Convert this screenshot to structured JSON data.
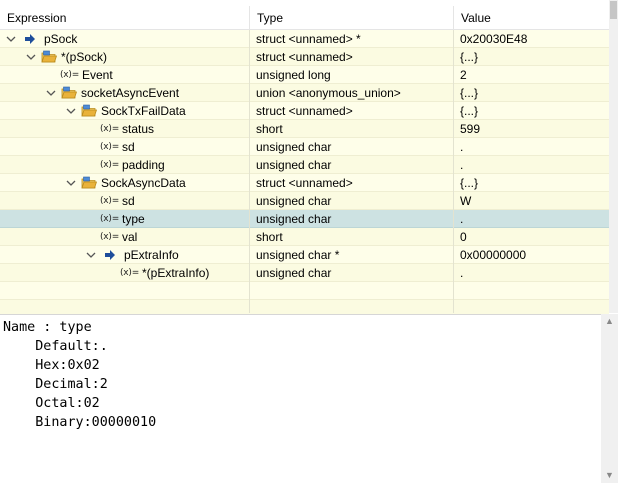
{
  "header": {
    "col_expression": "Expression",
    "col_type": "Type",
    "col_value": "Value"
  },
  "rows": [
    {
      "label": "pSock",
      "type": "struct <unnamed> *",
      "value": "0x20030E48",
      "icon": "pointer-arrow-icon",
      "expander": "expanded"
    },
    {
      "label": "*(pSock)",
      "type": "struct <unnamed>",
      "value": "{...}",
      "icon": "struct-folder-icon",
      "expander": "expanded"
    },
    {
      "label": "Event",
      "type": "unsigned long",
      "value": "2",
      "icon": "variable-icon",
      "expander": "none"
    },
    {
      "label": "socketAsyncEvent",
      "type": "union <anonymous_union>",
      "value": "{...}",
      "icon": "struct-folder-icon",
      "expander": "expanded"
    },
    {
      "label": "SockTxFailData",
      "type": "struct <unnamed>",
      "value": "{...}",
      "icon": "struct-folder-icon",
      "expander": "expanded"
    },
    {
      "label": "status",
      "type": "short",
      "value": "599",
      "icon": "variable-icon",
      "expander": "none"
    },
    {
      "label": "sd",
      "type": "unsigned char",
      "value": ".",
      "icon": "variable-icon",
      "expander": "none"
    },
    {
      "label": "padding",
      "type": "unsigned char",
      "value": ".",
      "icon": "variable-icon",
      "expander": "none"
    },
    {
      "label": "SockAsyncData",
      "type": "struct <unnamed>",
      "value": "{...}",
      "icon": "struct-folder-icon",
      "expander": "expanded"
    },
    {
      "label": "sd",
      "type": "unsigned char",
      "value": "W",
      "icon": "variable-icon",
      "expander": "none"
    },
    {
      "label": "type",
      "type": "unsigned char",
      "value": ".",
      "icon": "variable-icon",
      "expander": "none",
      "selected": true
    },
    {
      "label": "val",
      "type": "short",
      "value": "0",
      "icon": "variable-icon",
      "expander": "none"
    },
    {
      "label": "pExtraInfo",
      "type": "unsigned char *",
      "value": "0x00000000",
      "icon": "pointer-arrow-icon",
      "expander": "expanded"
    },
    {
      "label": "*(pExtraInfo)",
      "type": "unsigned char",
      "value": ".",
      "icon": "variable-icon",
      "expander": "none"
    }
  ],
  "var_icon_text": "(x)=",
  "details": {
    "lines": [
      "Name : type",
      "    Default:.",
      "    Hex:0x02",
      "    Decimal:2",
      "    Octal:02",
      "    Binary:00000010"
    ]
  },
  "colors": {
    "row_bg": "#fefee9",
    "row_selected": "#cde2e2",
    "pointer_icon": "#1f4e9b",
    "folder_icon": "#e9b23a"
  }
}
